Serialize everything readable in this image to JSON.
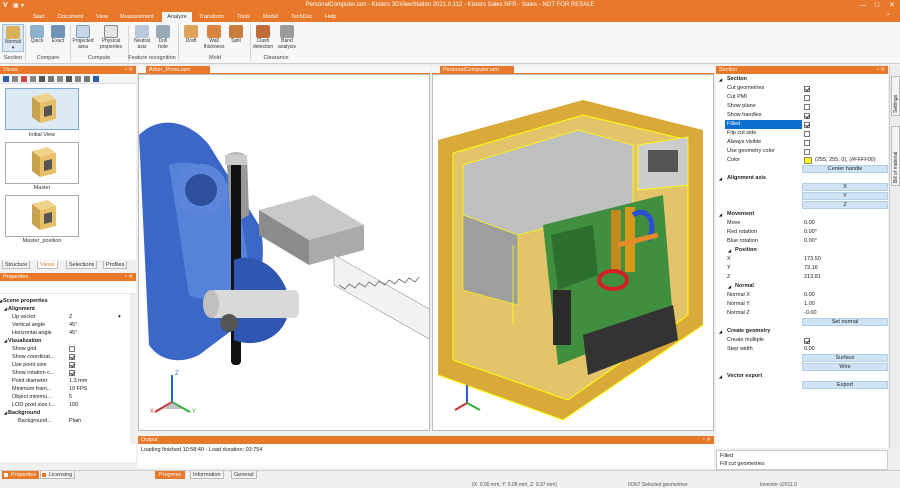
{
  "window": {
    "title": "PersonalComputer.iam - Kisters 3DViewStation 2021.0.112 - Kisters Sales NFR - Sales - NOT FOR RESALE",
    "app_logo": "V",
    "controls": [
      "—",
      "□",
      "✕"
    ]
  },
  "menu": {
    "tabs": [
      "Start",
      "Document",
      "View",
      "Measurement",
      "Analyze",
      "Transform",
      "Tools",
      "Model",
      "TechDoc",
      "Help"
    ],
    "active": "Analyze"
  },
  "ribbon": {
    "buttons": [
      {
        "label": "Normal",
        "label2": "▾",
        "icon": "section-normal-icon"
      },
      {
        "label": "Quick",
        "label2": "",
        "icon": "quick-compare-icon"
      },
      {
        "label": "Exact",
        "label2": "",
        "icon": "exact-compare-icon"
      },
      {
        "label": "Projected",
        "label2": "area",
        "icon": "projected-area-icon"
      },
      {
        "label": "Physical",
        "label2": "properties",
        "icon": "physical-properties-icon"
      },
      {
        "label": "Neutral",
        "label2": "axis",
        "icon": "neutral-axis-icon"
      },
      {
        "label": "Drill",
        "label2": "hole",
        "icon": "drill-hole-icon"
      },
      {
        "label": "Draft",
        "label2": "",
        "icon": "draft-icon"
      },
      {
        "label": "Wall",
        "label2": "thickness",
        "icon": "wall-thickness-icon"
      },
      {
        "label": "Split",
        "label2": "",
        "icon": "split-icon"
      },
      {
        "label": "Clash",
        "label2": "detection",
        "icon": "clash-detection-icon"
      },
      {
        "label": "Band",
        "label2": "analysis",
        "icon": "band-analysis-icon"
      }
    ],
    "groups": [
      "Section",
      "Compare",
      "Compute",
      "Feature recognition",
      "Mold",
      "Clearance"
    ]
  },
  "views_panel": {
    "title": "Views",
    "items": [
      "Initial View",
      "Master",
      "Master_position"
    ],
    "tabs": [
      "Structure",
      "Views",
      "Selections",
      "Profiles"
    ],
    "active_tab": "Views"
  },
  "properties_panel": {
    "title": "Properties",
    "rows": [
      {
        "type": "grp",
        "k": "Scene properties",
        "v": ""
      },
      {
        "type": "sub",
        "k": "Alignment",
        "v": ""
      },
      {
        "type": "row",
        "k": "Up vector",
        "v": "Z"
      },
      {
        "type": "row",
        "k": "Vertical angle",
        "v": "45°"
      },
      {
        "type": "row",
        "k": "Horizontal angle",
        "v": "45°"
      },
      {
        "type": "sub",
        "k": "Visualization",
        "v": ""
      },
      {
        "type": "chk",
        "k": "Show grid",
        "v": "off"
      },
      {
        "type": "chk",
        "k": "Show coordinat...",
        "v": "on"
      },
      {
        "type": "chk",
        "k": "Use point size",
        "v": "on"
      },
      {
        "type": "chk",
        "k": "Show rotation c...",
        "v": "on"
      },
      {
        "type": "row",
        "k": "Point diameter",
        "v": "1.3 mm"
      },
      {
        "type": "row",
        "k": "Minimum fram...",
        "v": "10 FPS"
      },
      {
        "type": "row",
        "k": "Object minimu...",
        "v": "5"
      },
      {
        "type": "row",
        "k": "LOD pixel size t...",
        "v": "100"
      },
      {
        "type": "sub",
        "k": "Background",
        "v": ""
      },
      {
        "type": "row2",
        "k": "Background...",
        "v": "Plain"
      }
    ],
    "tabs": [
      "Properties",
      "Licensing"
    ]
  },
  "viewports": {
    "left_tab": "Arbor_Press.iam",
    "right_tab": "PersonalComputer.iam",
    "axis": {
      "x": "X",
      "y": "Y",
      "z": "Z"
    }
  },
  "output_panel": {
    "title": "Output",
    "text": "Loading finished 10:58:40 - Load duration: 03:754",
    "tabs": [
      "Progress",
      "Information",
      "General"
    ]
  },
  "section_panel": {
    "title": "Section",
    "rows": [
      {
        "type": "grp",
        "k": "Section",
        "v": ""
      },
      {
        "type": "chk",
        "k": "Cut geometries",
        "v": "on"
      },
      {
        "type": "chk",
        "k": "Cut PMI",
        "v": "off"
      },
      {
        "type": "chk",
        "k": "Show plane",
        "v": "off"
      },
      {
        "type": "chk",
        "k": "Show handles",
        "v": "on"
      },
      {
        "type": "chkhl",
        "k": "Filled",
        "v": "on"
      },
      {
        "type": "chk",
        "k": "Flip cut side",
        "v": "off"
      },
      {
        "type": "chk",
        "k": "Always visible",
        "v": "off"
      },
      {
        "type": "chk",
        "k": "Use geometry color",
        "v": "off"
      },
      {
        "type": "color",
        "k": "Color",
        "v": "(255, 255, 0), (#FFFF00)"
      },
      {
        "type": "btn",
        "k": "",
        "v": "Center handle"
      },
      {
        "type": "grp",
        "k": "Alignment axis",
        "v": ""
      },
      {
        "type": "btn",
        "k": "",
        "v": "X"
      },
      {
        "type": "btn",
        "k": "",
        "v": "Y"
      },
      {
        "type": "btn",
        "k": "",
        "v": "Z"
      },
      {
        "type": "grp",
        "k": "Movement",
        "v": ""
      },
      {
        "type": "row",
        "k": "Move",
        "v": "0.00"
      },
      {
        "type": "row",
        "k": "Red rotation",
        "v": "0.00°"
      },
      {
        "type": "row",
        "k": "Blue rotation",
        "v": "0.00°"
      },
      {
        "type": "sub",
        "k": "Position",
        "v": ""
      },
      {
        "type": "row",
        "k": "X",
        "v": "173.50"
      },
      {
        "type": "row",
        "k": "Y",
        "v": "73.16"
      },
      {
        "type": "row",
        "k": "Z",
        "v": "213.81"
      },
      {
        "type": "sub",
        "k": "Normal",
        "v": ""
      },
      {
        "type": "row",
        "k": "Normal X",
        "v": "0.00"
      },
      {
        "type": "row",
        "k": "Normal Y",
        "v": "1.00"
      },
      {
        "type": "row",
        "k": "Normal Z",
        "v": "-0.00"
      },
      {
        "type": "btn",
        "k": "",
        "v": "Set normal"
      },
      {
        "type": "grp",
        "k": "Create geometry",
        "v": ""
      },
      {
        "type": "chk",
        "k": "Create multiple",
        "v": "on"
      },
      {
        "type": "row",
        "k": "Step width",
        "v": "0.00"
      },
      {
        "type": "btn",
        "k": "",
        "v": "Surface"
      },
      {
        "type": "btn",
        "k": "",
        "v": "Wire"
      },
      {
        "type": "grp",
        "k": "Vector export",
        "v": ""
      },
      {
        "type": "btn",
        "k": "",
        "v": "Export"
      }
    ],
    "side_tabs": [
      "Settings",
      "Bill of material"
    ],
    "help_title": "Filled",
    "help_text": "Fill cut geometries",
    "filled_color": "#FFFF00",
    "accent": "#E8792B"
  },
  "status": {
    "coords": "(X: 0.00 mm, Y: 0.08 mm, Z: 0.37 mm)",
    "selected": "0/367 Selected geometries",
    "version": "Inventor v2011.0"
  }
}
